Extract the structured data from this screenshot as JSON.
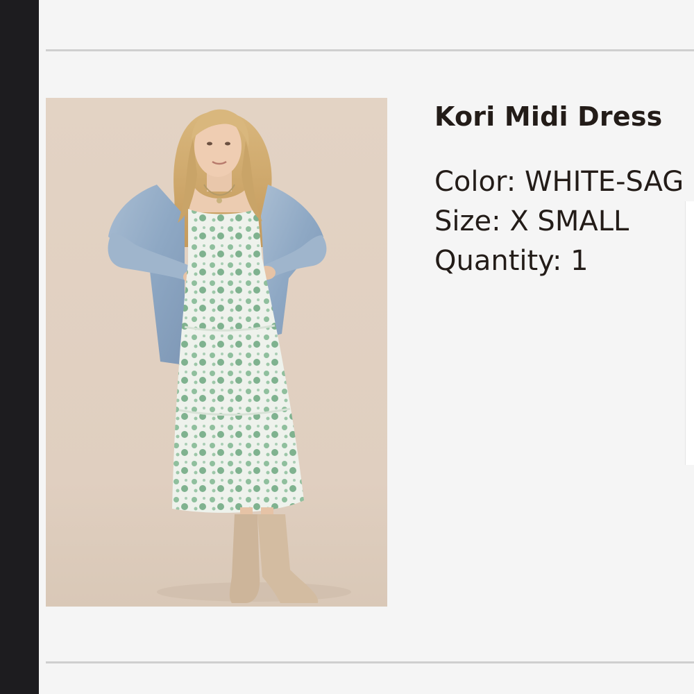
{
  "product": {
    "title": "Kori Midi Dress",
    "image_alt": "Model wearing Kori Midi Dress with denim jacket and cowboy boots",
    "details": {
      "color_label": "Color:",
      "color_value": "WHITE-SAG",
      "size_label": "Size:",
      "size_value": "X SMALL",
      "quantity_label": "Quantity:",
      "quantity_value": "1"
    }
  },
  "colors": {
    "sidebar": "#1d1c1f",
    "background": "#f5f5f5",
    "divider": "#cfcfcf",
    "text": "#231c18",
    "image_backdrop": "#e2d4c6"
  }
}
